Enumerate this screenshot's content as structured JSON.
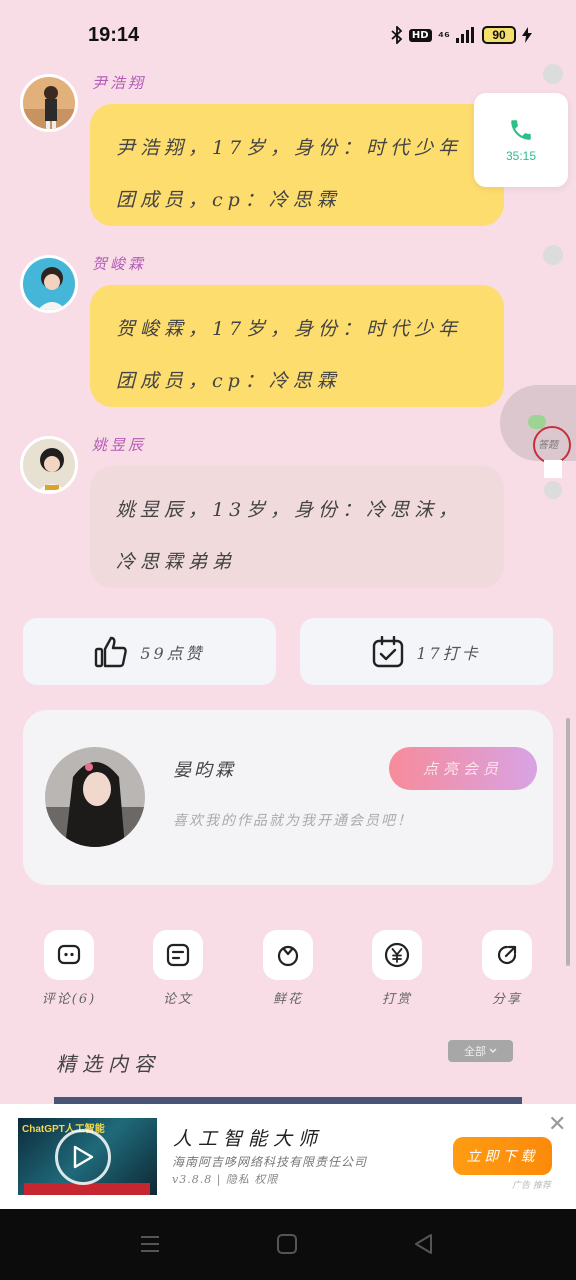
{
  "status_bar": {
    "time": "19:14",
    "hd": "HD",
    "signal": "⁴⁶",
    "battery": "90"
  },
  "messages": [
    {
      "sender": "尹浩翔",
      "text_line1": "尹浩翔，17岁，身份：时代少年",
      "text_line2": "团成员，cp：冷思霖",
      "bubble_color": "#fedd6f"
    },
    {
      "sender": "贺峻霖",
      "text_line1": "贺峻霖，17岁，身份：时代少年",
      "text_line2": "团成员，cp：冷思霖",
      "bubble_color": "#fedd6f"
    },
    {
      "sender": "姚昱辰",
      "text_line1": "姚昱辰，13岁，身份：冷思沫，",
      "text_line2": "冷思霖弟弟",
      "bubble_color": "#f1dadb"
    }
  ],
  "call_card": {
    "timer": "35:15",
    "icon": "phone-icon"
  },
  "float": {
    "label": "答题"
  },
  "actions": {
    "like_label": "59点赞",
    "checkin_label": "17打卡"
  },
  "author": {
    "name": "晏昀霖",
    "description": "喜欢我的作品就为我开通会员吧！",
    "member_button": "点亮会员"
  },
  "toolbar": [
    {
      "label": "评论(6)",
      "icon": "comment-icon"
    },
    {
      "label": "论文",
      "icon": "document-icon"
    },
    {
      "label": "鲜花",
      "icon": "flower-icon"
    },
    {
      "label": "打赏",
      "icon": "yuan-icon"
    },
    {
      "label": "分享",
      "icon": "share-icon"
    }
  ],
  "featured": {
    "title": "精选内容",
    "filter": "全部"
  },
  "ad": {
    "thumb_caption": "ChatGPT人工智能",
    "title": "人工智能大师",
    "company": "海南阿吉哆网络科技有限责任公司",
    "version": "v3.8.8 | 隐私 权限",
    "button": "立即下载",
    "source": "广告 推荐"
  },
  "colors": {
    "background": "#f8dde7",
    "accent_green": "#2dbf87",
    "ad_button": "#ff9c12"
  }
}
